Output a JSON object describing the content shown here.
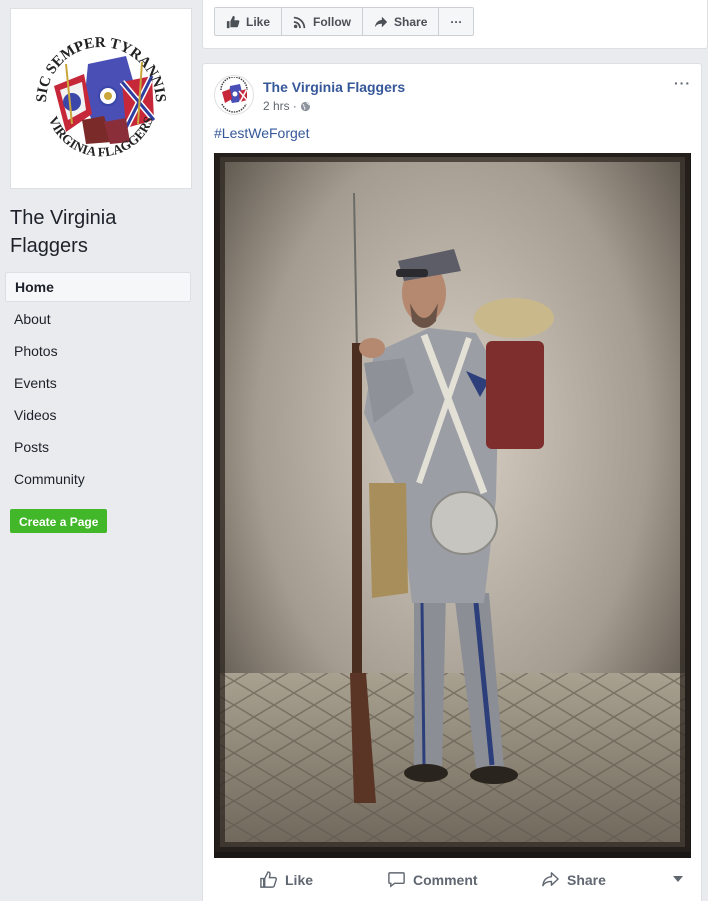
{
  "sidebar": {
    "page_name": "The Virginia Flaggers",
    "logo_text_top": "SIC SEMPER TYRANNIS",
    "logo_text_bottom": "VIRGINIA FLAGGERS",
    "nav": [
      {
        "label": "Home",
        "active": true
      },
      {
        "label": "About"
      },
      {
        "label": "Photos"
      },
      {
        "label": "Events"
      },
      {
        "label": "Videos"
      },
      {
        "label": "Posts"
      },
      {
        "label": "Community"
      }
    ],
    "create_page_label": "Create a Page"
  },
  "top_actions": {
    "like_label": "Like",
    "follow_label": "Follow",
    "share_label": "Share",
    "more_label": "···"
  },
  "post": {
    "author": "The Virginia Flaggers",
    "time": "2 hrs",
    "separator": "·",
    "options_label": "···",
    "hashtag": "#LestWeForget",
    "photo_icon": "confederate-soldier-photo",
    "actions": {
      "like_label": "Like",
      "comment_label": "Comment",
      "share_label": "Share"
    }
  },
  "colors": {
    "link_blue": "#365899",
    "green_button": "#42b72a",
    "background": "#e9ebee"
  }
}
